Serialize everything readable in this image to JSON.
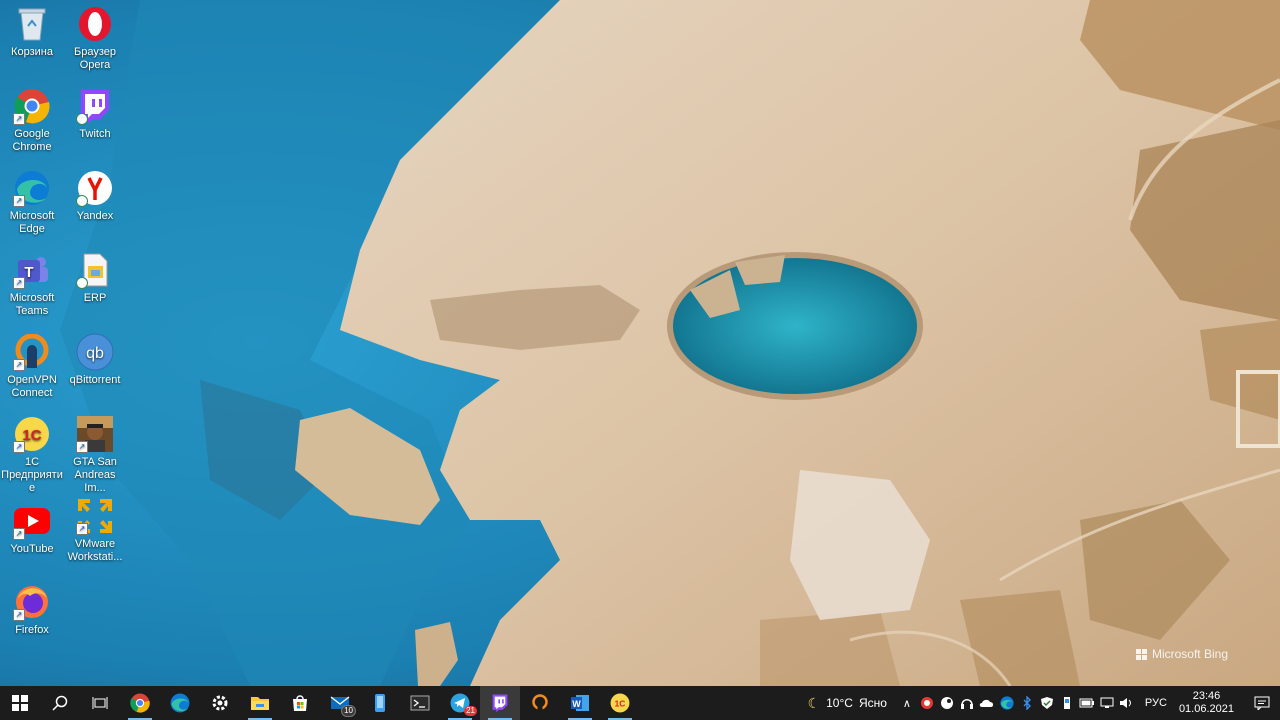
{
  "desktop": {
    "icons": [
      {
        "label": "Корзина",
        "icon": "recycle-bin-icon"
      },
      {
        "label": "Google Chrome",
        "icon": "chrome-icon"
      },
      {
        "label": "Microsoft Edge",
        "icon": "edge-icon"
      },
      {
        "label": "Microsoft Teams",
        "icon": "teams-icon"
      },
      {
        "label": "OpenVPN Connect",
        "icon": "openvpn-icon"
      },
      {
        "label": "1С Предприятие",
        "icon": "1c-icon"
      },
      {
        "label": "YouTube",
        "icon": "youtube-icon"
      },
      {
        "label": "Firefox",
        "icon": "firefox-icon"
      },
      {
        "label": "Браузер Opera",
        "icon": "opera-icon"
      },
      {
        "label": "Twitch",
        "icon": "twitch-icon"
      },
      {
        "label": "Yandex",
        "icon": "yandex-icon"
      },
      {
        "label": "ERP",
        "icon": "erp-file-icon"
      },
      {
        "label": "qBittorrent",
        "icon": "qbittorrent-icon"
      },
      {
        "label": "GTA San Andreas Im...",
        "icon": "gta-icon"
      },
      {
        "label": "VMware Workstati...",
        "icon": "vmware-icon"
      }
    ],
    "watermark": "Microsoft Bing"
  },
  "taskbar": {
    "buttons": [
      {
        "name": "start-button",
        "icon": "windows-icon"
      },
      {
        "name": "search-button",
        "icon": "search-icon"
      },
      {
        "name": "task-view-button",
        "icon": "task-view-icon"
      },
      {
        "name": "taskbar-chrome",
        "icon": "chrome-icon"
      },
      {
        "name": "taskbar-edge",
        "icon": "edge-icon"
      },
      {
        "name": "taskbar-settings",
        "icon": "gear-icon"
      },
      {
        "name": "taskbar-explorer",
        "icon": "folder-icon"
      },
      {
        "name": "taskbar-store",
        "icon": "store-icon"
      },
      {
        "name": "taskbar-mail",
        "icon": "mail-icon",
        "badge": "10"
      },
      {
        "name": "taskbar-phone",
        "icon": "phone-icon"
      },
      {
        "name": "taskbar-terminal",
        "icon": "terminal-icon"
      },
      {
        "name": "taskbar-telegram",
        "icon": "telegram-icon",
        "badge": "21"
      },
      {
        "name": "taskbar-twitch",
        "icon": "twitch-icon"
      },
      {
        "name": "taskbar-openvpn",
        "icon": "openvpn-icon"
      },
      {
        "name": "taskbar-word",
        "icon": "word-icon"
      },
      {
        "name": "taskbar-1c",
        "icon": "1c-icon"
      }
    ],
    "weather": {
      "icon": "moon-icon",
      "temp": "10°C",
      "condition": "Ясно"
    },
    "tray_icons": [
      "chevron-up-icon",
      "antivirus-icon",
      "steam-icon",
      "headset-icon",
      "onedrive-icon",
      "edge-icon",
      "bluetooth-icon",
      "security-icon",
      "usb-icon",
      "battery-icon",
      "network-icon",
      "volume-icon"
    ],
    "language": "РУС",
    "time": "23:46",
    "date": "01.06.2021"
  },
  "colors": {
    "taskbar": "#1c1c1c",
    "accent": "#76b9ed",
    "sea": "#1e6f9e",
    "rock": "#d9c2a6"
  }
}
